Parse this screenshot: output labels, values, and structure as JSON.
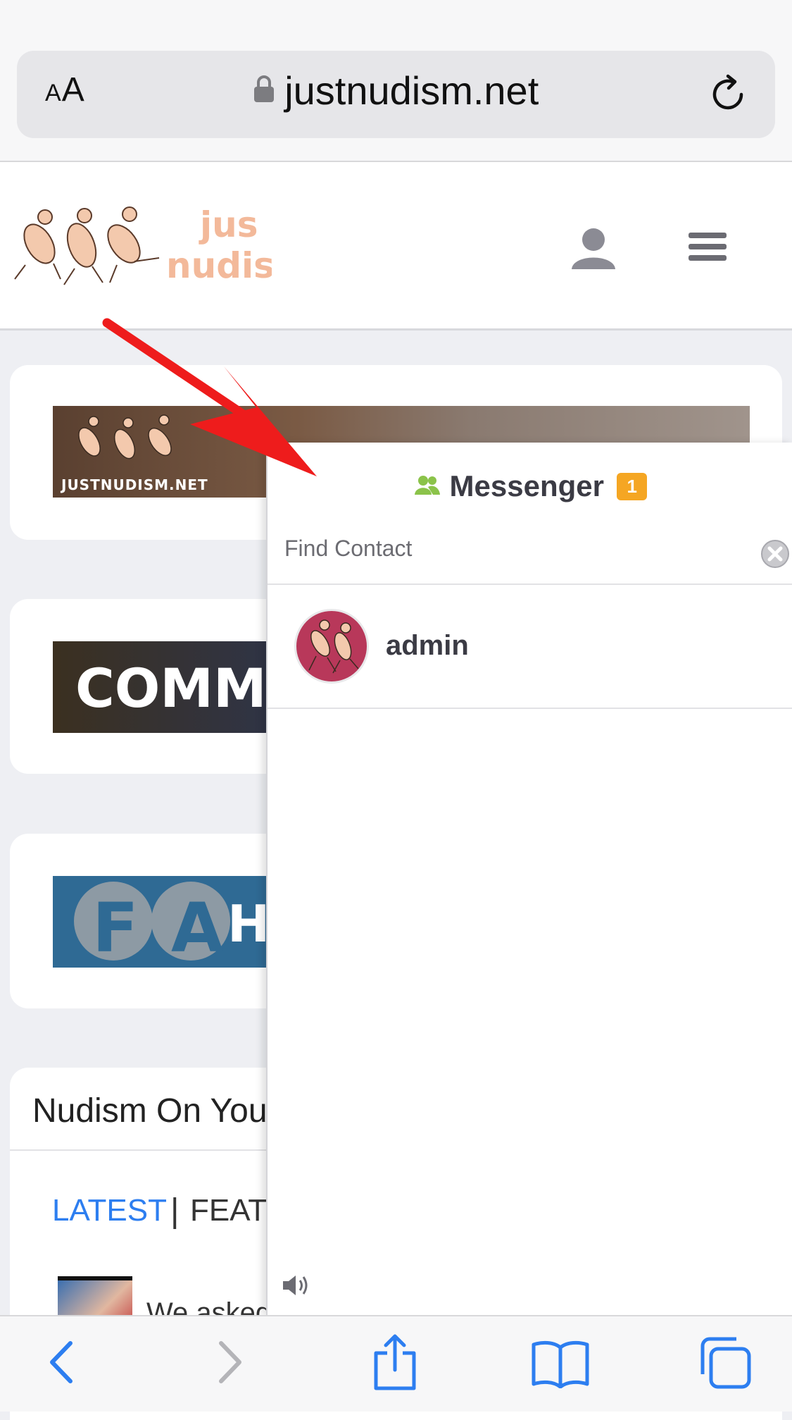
{
  "browser": {
    "text_size_label": "AA",
    "url": "justnudism.net"
  },
  "site": {
    "logo_text_line1": "jus",
    "logo_text_line2": "nudis"
  },
  "banners": {
    "banner_1_watermark": "JUSTNUDISM.NET",
    "banner_2_text": "COMMU",
    "banner_3_text": "H",
    "banner_3_letters": [
      "F",
      "A"
    ]
  },
  "youtube_section": {
    "title": "Nudism On Yout",
    "tabs": {
      "latest": "LATEST",
      "separator": "|",
      "featured": "FEAT"
    },
    "video_title": "We asked"
  },
  "messenger": {
    "title": "Messenger",
    "unread_count": "1",
    "search_placeholder": "Find Contact",
    "contacts": [
      {
        "name": "admin"
      }
    ]
  },
  "colors": {
    "accent_blue": "#2d7ef0",
    "badge_orange": "#f5a623",
    "contacts_icon_green": "#8bc34a",
    "annotation_red": "#ee1c1c"
  }
}
